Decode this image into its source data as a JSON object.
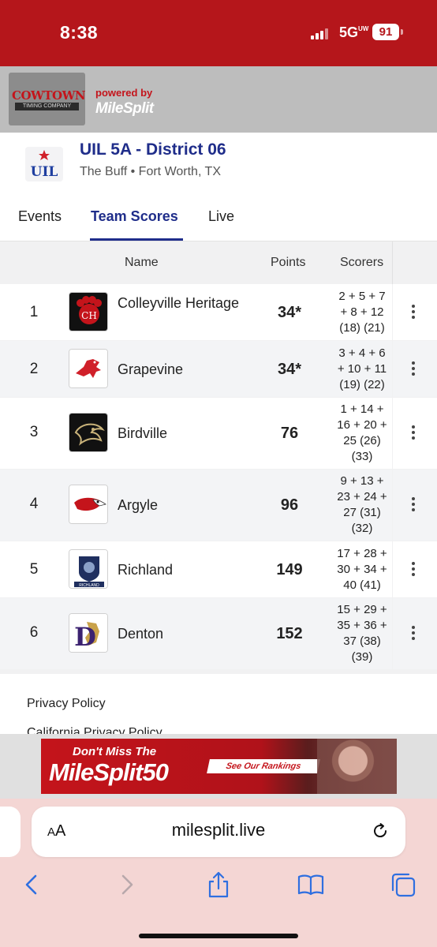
{
  "status_bar": {
    "time": "8:38",
    "network": "5G",
    "network_sub": "UW",
    "battery": "91"
  },
  "sponsor": {
    "logo_text": "COWTOWN",
    "logo_subtext": "TIMING COMPANY",
    "powered_by": "powered by",
    "brand": "MileSplit"
  },
  "meet": {
    "logo_text": "UIL",
    "title": "UIL 5A - District 06",
    "subtitle": "The Buff • Fort Worth, TX"
  },
  "tabs": [
    {
      "label": "Events"
    },
    {
      "label": "Team Scores"
    },
    {
      "label": "Live"
    }
  ],
  "active_tab": "Team Scores",
  "table": {
    "headers": {
      "name": "Name",
      "points": "Points",
      "scorers": "Scorers"
    },
    "rows": [
      {
        "rank": "1",
        "team": "Colleyville Heritage",
        "logo_text": "CH",
        "points": "34*",
        "scorers": [
          "2 + 5 + 7",
          "+ 8 + 12",
          "(18) (21)"
        ]
      },
      {
        "rank": "2",
        "team": "Grapevine",
        "logo_text": "",
        "points": "34*",
        "scorers": [
          "3 + 4 + 6",
          "+ 10 + 11",
          "(19) (22)"
        ]
      },
      {
        "rank": "3",
        "team": "Birdville",
        "logo_text": "",
        "points": "76",
        "scorers": [
          "1 + 14 +",
          "16 + 20 +",
          "25 (26)",
          "(33)"
        ]
      },
      {
        "rank": "4",
        "team": "Argyle",
        "logo_text": "",
        "points": "96",
        "scorers": [
          "9 + 13 +",
          "23 + 24 +",
          "27 (31)",
          "(32)"
        ]
      },
      {
        "rank": "5",
        "team": "Richland",
        "logo_text": "RICHLAND",
        "points": "149",
        "scorers": [
          "17 + 28 +",
          "30 + 34 +",
          "40 (41)"
        ]
      },
      {
        "rank": "6",
        "team": "Denton",
        "logo_text": "D",
        "points": "152",
        "scorers": [
          "15 + 29 +",
          "35 + 36 +",
          "37 (38)",
          "(39)"
        ]
      }
    ]
  },
  "footer": {
    "privacy": "Privacy Policy",
    "ca_privacy": "California Privacy Policy"
  },
  "ad": {
    "top_line": "Don't Miss The",
    "main": "MileSplit50",
    "cta": "See Our Rankings"
  },
  "browser": {
    "aa_small": "A",
    "aa_large": "A",
    "url": "milesplit.live"
  },
  "colors": {
    "brand_red": "#b5161b",
    "meet_blue": "#1f2d8a",
    "safari_tint": "#f4d6d4"
  }
}
